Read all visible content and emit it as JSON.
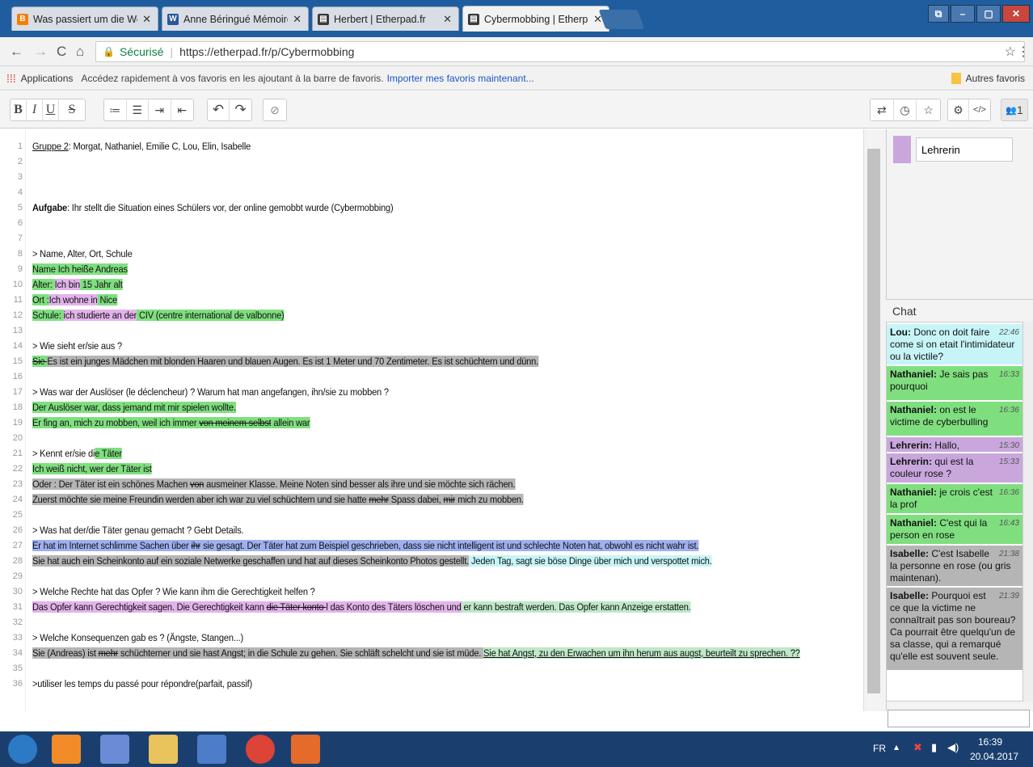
{
  "browser": {
    "tabs": [
      {
        "title": "Was passiert um die Wel",
        "icon": "blogger-icon",
        "color": "#f57d00",
        "glyph": "B"
      },
      {
        "title": "Anne Béringué Mémoire",
        "icon": "word-icon",
        "color": "#2b579a",
        "glyph": "W"
      },
      {
        "title": "Herbert | Etherpad.fr",
        "icon": "etherpad-icon",
        "color": "#3a3a3a",
        "glyph": "▤"
      },
      {
        "title": "Cybermobbing | Etherpa",
        "icon": "etherpad-icon",
        "color": "#3a3a3a",
        "glyph": "▤"
      }
    ],
    "secure_label": "Sécurisé",
    "url": "https://etherpad.fr/p/Cybermobbing",
    "bookmarks": {
      "apps": "Applications",
      "hint": "Accédez rapidement à vos favoris en les ajoutant à la barre de favoris.",
      "import_link": "Importer mes favoris maintenant...",
      "other": "Autres favoris"
    }
  },
  "toolbar": {
    "user_count": "1"
  },
  "editor": {
    "lines": [
      {
        "n": "1",
        "segs": [
          [
            "Gruppe 2",
            "u"
          ],
          [
            ": Morgat, Nathaniel, Emilie C, Lou, Elin, Isabelle",
            ""
          ]
        ]
      },
      {
        "n": "2",
        "segs": []
      },
      {
        "n": "3",
        "segs": []
      },
      {
        "n": "4",
        "segs": []
      },
      {
        "n": "5",
        "segs": [
          [
            "Aufgabe",
            "bold"
          ],
          [
            ": Ihr stellt die Situation eines Schülers vor, der online gemobbt wurde (Cybermobbing)",
            ""
          ]
        ]
      },
      {
        "n": "6",
        "segs": []
      },
      {
        "n": "7",
        "segs": []
      },
      {
        "n": "8",
        "segs": [
          [
            "> Name, Alter, Ort, Schule",
            ""
          ]
        ]
      },
      {
        "n": "9",
        "segs": [
          [
            "Name Ich heiße Andreas",
            "g"
          ]
        ]
      },
      {
        "n": "10",
        "segs": [
          [
            "Alter: ",
            "g"
          ],
          [
            "Ich bin",
            "p"
          ],
          [
            " 15 Jahr alt",
            "g"
          ]
        ]
      },
      {
        "n": "11",
        "segs": [
          [
            "Ort :",
            "g"
          ],
          [
            "Ich wohne in",
            "p"
          ],
          [
            " Nice",
            "g"
          ]
        ]
      },
      {
        "n": "12",
        "segs": [
          [
            "Schule: ",
            "g"
          ],
          [
            "ich studierte an der",
            "p"
          ],
          [
            " CIV (centre international de valbonne)",
            "g"
          ]
        ]
      },
      {
        "n": "13",
        "segs": []
      },
      {
        "n": "14",
        "segs": [
          [
            "> Wie sieht er/sie aus ?",
            ""
          ]
        ]
      },
      {
        "n": "15",
        "segs": [
          [
            "Sie ",
            "g s"
          ],
          [
            "Es ist ein junges Mädchen mit blonden Haaren und blauen Augen.",
            "gr"
          ],
          [
            " Es ist 1 Meter und 70 Zentimeter.",
            "gr"
          ],
          [
            " Es ist schüchtern und dünn.",
            "gr"
          ]
        ]
      },
      {
        "n": "16",
        "segs": []
      },
      {
        "n": "17",
        "segs": [
          [
            "> Was war der Auslöser (le déclencheur) ? Warum hat man angefangen, ihn/sie zu mobben ?",
            ""
          ]
        ]
      },
      {
        "n": "18",
        "segs": [
          [
            "Der Auslöser war, dass jemand mit mir spielen wollte.",
            "g"
          ]
        ]
      },
      {
        "n": "19",
        "segs": [
          [
            "Er fing an, mich zu mobben, weil ich immer ",
            "g"
          ],
          [
            "von meinem selbst",
            "g s"
          ],
          [
            " allein war",
            "g"
          ]
        ]
      },
      {
        "n": "20",
        "segs": []
      },
      {
        "n": "21",
        "segs": [
          [
            "> Kennt er/sie di",
            ""
          ],
          [
            "e Täter",
            "g"
          ]
        ]
      },
      {
        "n": "22",
        "segs": [
          [
            "Ich weiß nicht, wer der Täter ist",
            "g"
          ]
        ]
      },
      {
        "n": "23",
        "segs": [
          [
            "Oder : Der Täter ist ein schönes Machen ",
            "gr"
          ],
          [
            "von",
            "gr s"
          ],
          [
            " ausmeiner Klasse. Meine Noten sind besser als ihre und sie möchte sich rächen.",
            "gr"
          ]
        ]
      },
      {
        "n": "24",
        "segs": [
          [
            "Zuerst möchte sie meine Freundin werden aber ich war zu viel schüchtern und sie hatte ",
            "gr"
          ],
          [
            "mehr",
            "gr s"
          ],
          [
            " Spass dabei, ",
            "gr"
          ],
          [
            "mir",
            "gr s"
          ],
          [
            "  mich zu mobben.",
            "gr"
          ]
        ]
      },
      {
        "n": "25",
        "segs": []
      },
      {
        "n": "26",
        "segs": [
          [
            "> Was hat der/die Täter genau gemacht ? Gebt Details.",
            ""
          ]
        ]
      },
      {
        "n": "27",
        "segs": [
          [
            "Er hat im Internet schlimme Sachen über ",
            "b"
          ],
          [
            "ihr",
            "b s"
          ],
          [
            " sie gesagt. Der Täter hat zum Beispiel geschrieben, dass sie nicht intelligent ist und schlechte Noten hat, obwohl es nicht wahr ist.",
            "b"
          ]
        ]
      },
      {
        "n": "28",
        "segs": [
          [
            "Sie hat auch ein Scheinkonto auf ein soziale Netwerke geschaffen und hat auf dieses Scheinkonto Photos gestellt.",
            "gr"
          ],
          [
            "  Jeden Tag, sagt sie böse Dinge über mich und verspottet mich.",
            "c"
          ]
        ]
      },
      {
        "n": "29",
        "segs": []
      },
      {
        "n": "30",
        "segs": [
          [
            "> Welche Rechte hat das Opfer ? Wie kann ihm die Gerechtigkeit helfen ?",
            ""
          ]
        ]
      },
      {
        "n": "31",
        "segs": [
          [
            "Das Opfer kann Gerechtigkeit sagen.  Die Gerechtigkeit kann ",
            "p"
          ],
          [
            "die Täter konto ",
            "p s"
          ],
          [
            "l das Konto des Täters löschen und",
            "p"
          ],
          [
            "  er kann  bestraft werden. Das Opfer kann Anzeige erstatten.",
            "l"
          ]
        ]
      },
      {
        "n": "32",
        "segs": []
      },
      {
        "n": "33",
        "segs": [
          [
            "> Welche Konsequenzen gab es ? (Ängste, Stangen...)",
            ""
          ]
        ]
      },
      {
        "n": "34",
        "segs": [
          [
            "Sie (Andreas) ist ",
            "gr"
          ],
          [
            "mehr",
            "gr s"
          ],
          [
            " schüchterner und sie hast Angst; in die Schule zu gehen. Sie schläft schelcht und sie ist müde. ",
            "gr"
          ],
          [
            "Sie hat Angst, zu den Erwachen um ihn herum aus augst, beurteilt zu sprechen. ??",
            "l u"
          ]
        ]
      },
      {
        "n": "35",
        "segs": []
      },
      {
        "n": "36",
        "segs": [
          [
            ">utiliser les temps du passé  pour répondre(parfait, passif)",
            ""
          ]
        ]
      }
    ]
  },
  "users": {
    "name": "Lehrerin",
    "color": "#c9a7dd"
  },
  "chat": {
    "title": "Chat",
    "messages": [
      {
        "author": "Lou:",
        "text": "Donc on doit faire come si on etait l'intimidateur ou la victile?",
        "time": "22:46",
        "bg": "#c7f5f7"
      },
      {
        "author": "Nathaniel:",
        "text": "Je sais pas pourquoi",
        "time": "16:33",
        "bg": "#7fdf7f"
      },
      {
        "author": "Nathaniel:",
        "text": "on est le victime de cyberbulling",
        "time": "16:36",
        "bg": "#7fdf7f"
      },
      {
        "author": "Lehrerin:",
        "text": "Hallo,",
        "time": "15:30",
        "bg": "#c9a7dd"
      },
      {
        "author": "Lehrerin:",
        "text": "qui est la couleur rose ?",
        "time": "15:33",
        "bg": "#c9a7dd"
      },
      {
        "author": "Nathaniel:",
        "text": "je crois c'est la prof",
        "time": "16:36",
        "bg": "#7fdf7f"
      },
      {
        "author": "Nathaniel:",
        "text": "C'est qui la person en rose",
        "time": "16:43",
        "bg": "#7fdf7f"
      },
      {
        "author": "Isabelle:",
        "text": "C'est Isabelle la personne en rose (ou gris maintenan).",
        "time": "21:38",
        "bg": "#b5b5b5"
      },
      {
        "author": "Isabelle:",
        "text": "Pourquoi est ce que la victime ne connaîtrait pas son boureau? Ca pourrait être quelqu'un de sa classe, qui a remarqué qu'elle est souvent seule.",
        "time": "21:39",
        "bg": "#b5b5b5"
      }
    ]
  },
  "taskbar": {
    "lang": "FR",
    "time": "16:39",
    "date": "20.04.2017"
  }
}
